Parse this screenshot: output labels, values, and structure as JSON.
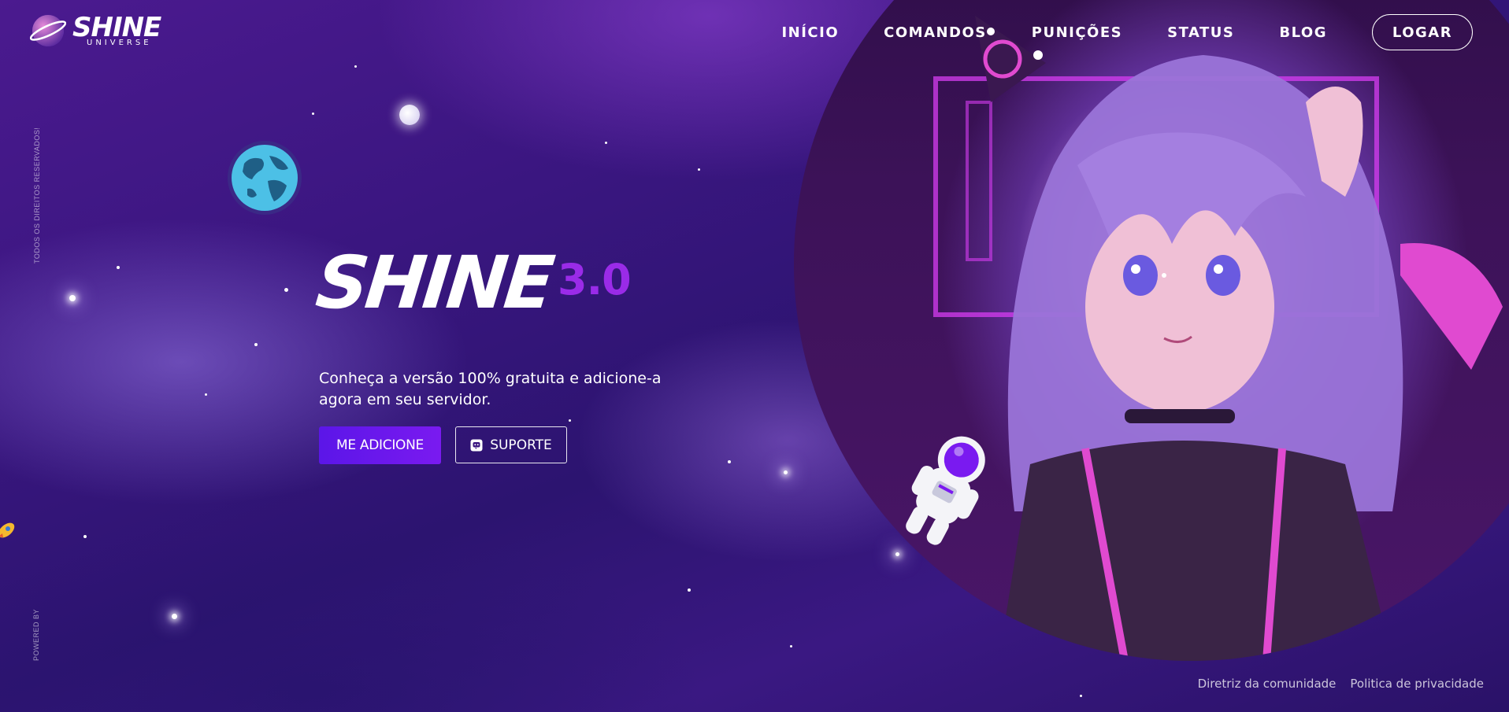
{
  "logo": {
    "wordmark": "SHINE",
    "trademark": "™",
    "subtitle": "UNIVERSE"
  },
  "nav": {
    "links": [
      "INÍCIO",
      "COMANDOS",
      "PUNIÇÕES",
      "STATUS",
      "BLOG"
    ],
    "login": "LOGAR"
  },
  "side": {
    "rights": "TODOS OS DIREITOS RESERVADOS!",
    "powered": "POWERED BY"
  },
  "hero": {
    "wordmark": "SHINE",
    "trademark": "™",
    "version": "3.0",
    "tagline": "Conheça a versão 100% gratuita e adicione-a agora em seu servidor.",
    "add_button": "ME ADICIONE",
    "support_button": "SUPORTE"
  },
  "footer": {
    "links": [
      "Diretriz da comunidade",
      "Politica de privacidade"
    ]
  },
  "colors": {
    "accent": "#7a1af0",
    "version": "#9a2be8",
    "background": "#3a1680",
    "planet": "#4cc0e6"
  }
}
